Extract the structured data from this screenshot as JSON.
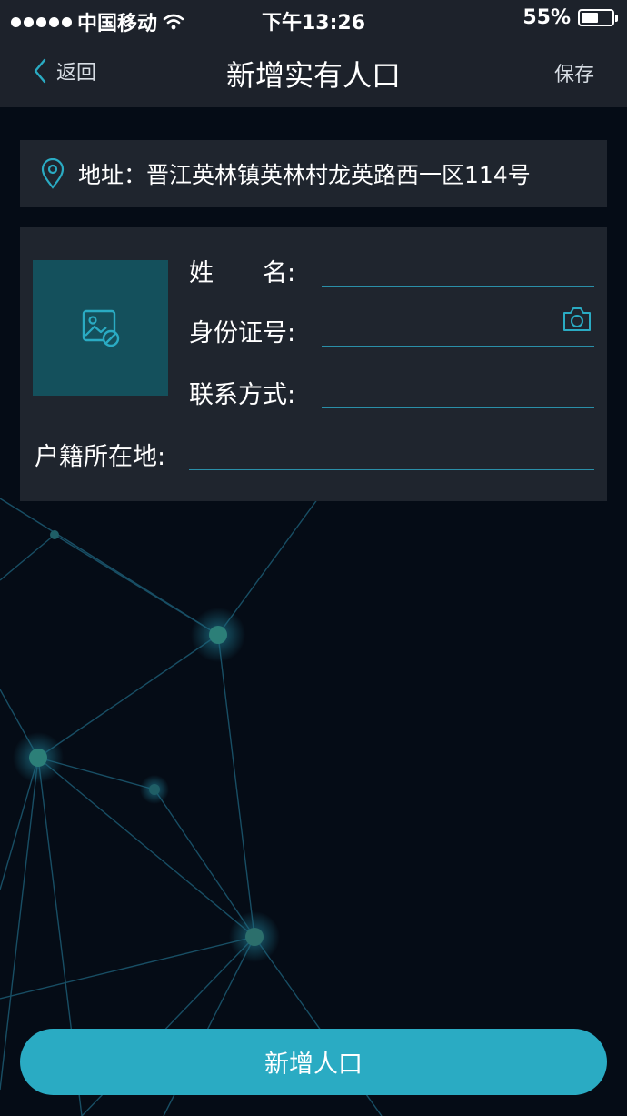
{
  "status_bar": {
    "carrier": "中国移动",
    "time": "下午13:26",
    "battery_text": "55%",
    "battery_level": 0.55
  },
  "nav": {
    "back_label": "返回",
    "title": "新增实有人口",
    "save_label": "保存"
  },
  "address": {
    "text": "地址：晋江英林镇英林村龙英路西一区114号"
  },
  "form": {
    "name_label": "姓　　名:",
    "id_label": "身份证号:",
    "contact_label": "联系方式:",
    "hukou_label": "户籍所在地:",
    "name_value": "",
    "id_value": "",
    "contact_value": "",
    "hukou_value": ""
  },
  "icons": {
    "back": "chevron-left-icon",
    "location": "location-pin-icon",
    "photo": "image-placeholder-icon",
    "camera": "camera-icon"
  },
  "colors": {
    "accent": "#2aabc3",
    "card_bg": "#1f252e",
    "photo_bg": "#14505c",
    "nav_bg": "#1d222b"
  },
  "submit": {
    "label": "新增人口"
  }
}
